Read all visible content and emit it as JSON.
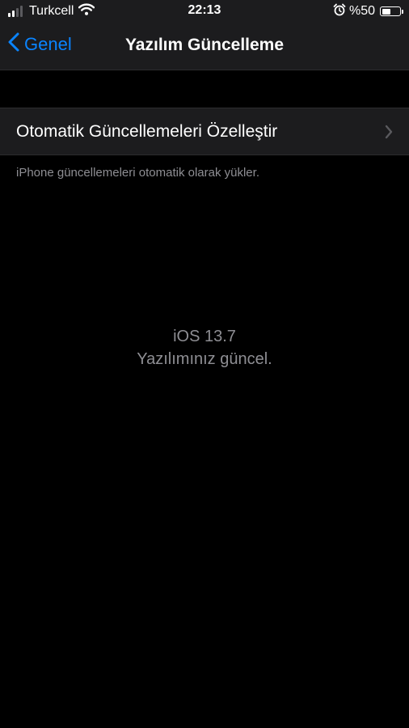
{
  "status_bar": {
    "carrier": "Turkcell",
    "time": "22:13",
    "battery_percent": "%50",
    "battery_level": 0.5,
    "icons": [
      "signal-icon",
      "wifi-icon",
      "alarm-icon",
      "battery-icon"
    ]
  },
  "nav": {
    "back_label": "Genel",
    "title": "Yazılım Güncelleme"
  },
  "settings": {
    "auto_update_label": "Otomatik Güncellemeleri Özelleştir",
    "auto_update_footer": "iPhone güncellemeleri otomatik olarak yükler."
  },
  "update_status": {
    "version": "iOS 13.7",
    "message": "Yazılımınız güncel."
  },
  "colors": {
    "accent": "#0a84ff",
    "background": "#000000",
    "grouped_background": "#1c1c1e",
    "secondary_text": "#8e8e93"
  }
}
